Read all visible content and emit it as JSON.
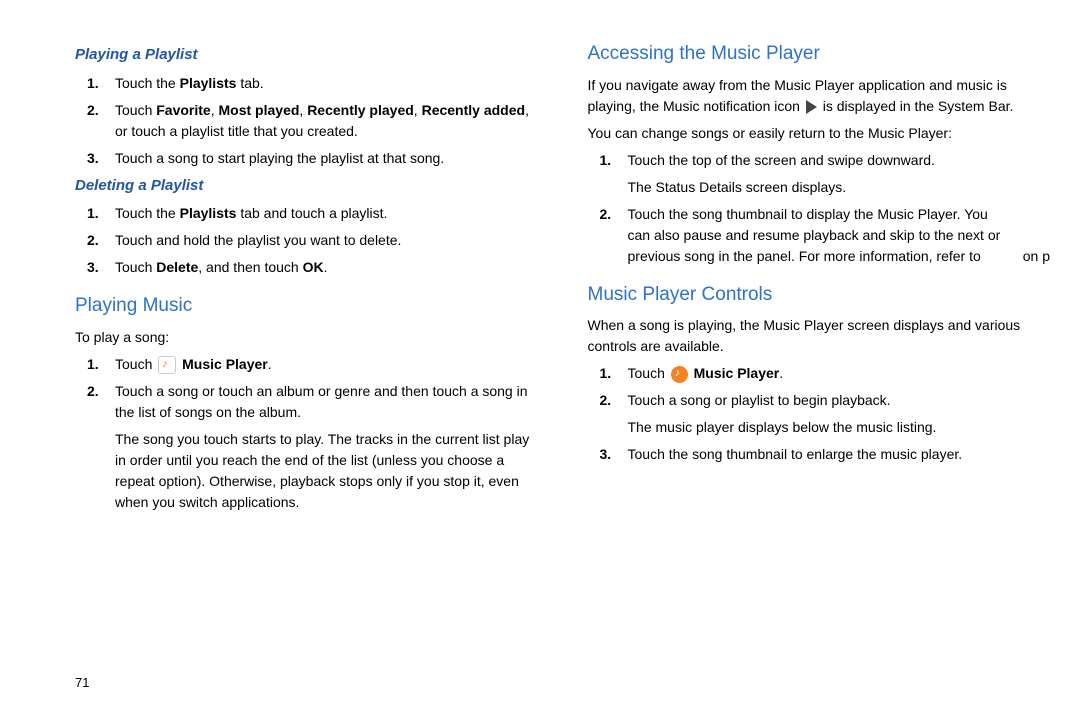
{
  "pageNumber": "71",
  "left": {
    "sub1": "Playing a Playlist",
    "l1_1a": "Touch the ",
    "l1_1b": "Playlists",
    "l1_1c": " tab.",
    "l1_2a": "Touch ",
    "l1_2b": "Favorite",
    "l1_2c": ", ",
    "l1_2d": "Most played",
    "l1_2e": ", ",
    "l1_2f": "Recently played",
    "l1_2g": ", ",
    "l1_2h": "Recently added",
    "l1_2i": ", or touch a playlist title that you created.",
    "l1_3": "Touch a song to start playing the playlist at that song.",
    "sub2": "Deleting a Playlist",
    "l2_1a": "Touch the ",
    "l2_1b": "Playlists",
    "l2_1c": " tab and touch a playlist.",
    "l2_2": "Touch and hold the playlist you want to delete.",
    "l2_3a": "Touch ",
    "l2_3b": "Delete",
    "l2_3c": ", and then touch ",
    "l2_3d": "OK",
    "l2_3e": ".",
    "head1": "Playing Music",
    "p1": "To play a song:",
    "l3_1a": "Touch ",
    "l3_1b": " Music Player",
    "l3_1c": ".",
    "l3_2": "Touch a song or touch an album or genre and then touch a song in the list of songs on the album.",
    "l3_2p": "The song you touch starts to play. The tracks in the current list play in order until you reach the end of the list (unless you choose a repeat option). Otherwise, playback stops only if you stop it, even when you switch applications."
  },
  "right": {
    "head1": "Accessing the Music Player",
    "p1a": "If you navigate away from the Music Player application and music is playing, the Music notification icon ",
    "p1b": " is displayed in the System Bar.",
    "p2": "You can change songs or easily return to the Music Player:",
    "r1_1": "Touch the top of the screen and swipe downward.",
    "r1_1p": "The Status Details screen displays.",
    "r1_2": "Touch the song thumbnail to display the Music Player. You can also pause and resume playback and skip to the next or previous song in the panel. For more information, refer to",
    "r1_2tail": "on p",
    "head2": "Music Player Controls",
    "p3": "When a song is playing, the Music Player screen displays and various controls are available.",
    "r2_1a": "Touch ",
    "r2_1b": " Music Player",
    "r2_1c": ".",
    "r2_2": "Touch a song or playlist to begin playback.",
    "r2_2p": "The music player displays below the music listing.",
    "r2_3": "Touch the song thumbnail to enlarge the music player."
  }
}
